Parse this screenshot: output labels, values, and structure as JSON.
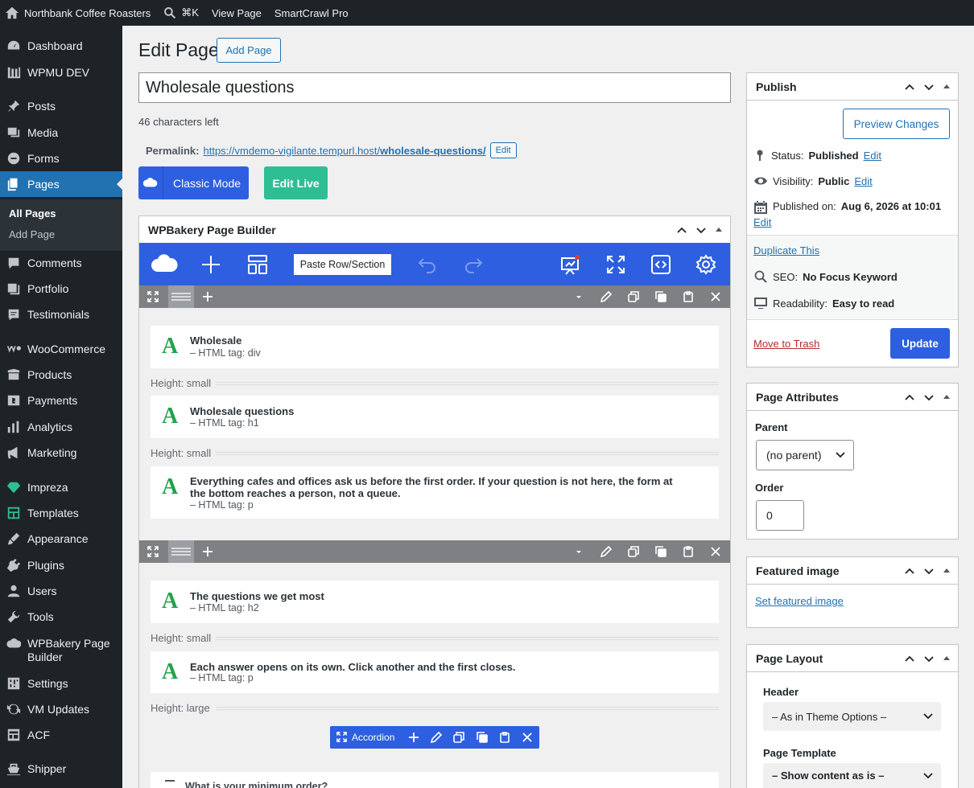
{
  "admin_bar": {
    "site_name": "Northbank Coffee Roasters",
    "search_shortcut": "⌘K",
    "view_page": "View Page",
    "plugin": "SmartCrawl Pro"
  },
  "sidebar": {
    "items": [
      {
        "label": "Dashboard",
        "icon": "dashboard-icon"
      },
      {
        "label": "WPMU DEV",
        "icon": "wpmudev-icon"
      },
      {
        "label": "Posts",
        "icon": "pin-icon"
      },
      {
        "label": "Media",
        "icon": "media-icon"
      },
      {
        "label": "Forms",
        "icon": "forms-icon"
      },
      {
        "label": "Pages",
        "icon": "pages-icon"
      },
      {
        "label": "Comments",
        "icon": "comments-icon"
      },
      {
        "label": "Portfolio",
        "icon": "portfolio-icon"
      },
      {
        "label": "Testimonials",
        "icon": "testimonials-icon"
      },
      {
        "label": "WooCommerce",
        "icon": "woocommerce-icon"
      },
      {
        "label": "Products",
        "icon": "products-icon"
      },
      {
        "label": "Payments",
        "icon": "payments-icon"
      },
      {
        "label": "Analytics",
        "icon": "analytics-icon"
      },
      {
        "label": "Marketing",
        "icon": "megaphone-icon"
      },
      {
        "label": "Impreza",
        "icon": "diamond-icon"
      },
      {
        "label": "Templates",
        "icon": "templates-icon"
      },
      {
        "label": "Appearance",
        "icon": "brush-icon"
      },
      {
        "label": "Plugins",
        "icon": "plug-icon"
      },
      {
        "label": "Users",
        "icon": "user-icon"
      },
      {
        "label": "Tools",
        "icon": "wrench-icon"
      },
      {
        "label": "WPBakery Page Builder",
        "icon": "wpbakery-icon"
      },
      {
        "label": "Settings",
        "icon": "settings-icon"
      },
      {
        "label": "VM Updates",
        "icon": "updates-icon"
      },
      {
        "label": "ACF",
        "icon": "acf-icon"
      },
      {
        "label": "Shipper",
        "icon": "shipper-icon"
      }
    ],
    "submenu": [
      "All Pages",
      "Add Page"
    ]
  },
  "editor": {
    "heading": "Edit Page",
    "add_page": "Add Page",
    "title_value": "Wholesale questions",
    "chars_left": "46 characters left",
    "permalink_label": "Permalink:",
    "permalink_base": "https://vmdemo-vigilante.tempurl.host/",
    "permalink_slug": "wholesale-questions/",
    "permalink_edit": "Edit",
    "classic_mode": "Classic Mode",
    "edit_live": "Edit Live"
  },
  "builder": {
    "title": "WPBakery Page Builder",
    "paste_label": "Paste Row/Section",
    "rows": [
      {
        "elements": [
          {
            "title": "Wholesale",
            "sub": "– HTML tag: div",
            "height": "Height: small"
          },
          {
            "title": "Wholesale questions",
            "sub": "– HTML tag: h1",
            "height": "Height: small"
          },
          {
            "title": "Everything cafes and offices ask us before the first order. If your question is not here, the form at the bottom reaches a person, not a queue.",
            "sub": "– HTML tag: p"
          }
        ]
      },
      {
        "elements": [
          {
            "title": "The questions we get most",
            "sub": "– HTML tag: h2",
            "height": "Height: small"
          },
          {
            "title": "Each answer opens on its own. Click another and the first closes.",
            "sub": "– HTML tag: p",
            "height": "Height: large"
          }
        ]
      }
    ],
    "accordion_label": "Accordion",
    "accordion_item": "What is your minimum order?"
  },
  "publish": {
    "title": "Publish",
    "preview": "Preview Changes",
    "status_label": "Status:",
    "status_value": "Published",
    "visibility_label": "Visibility:",
    "visibility_value": "Public",
    "published_label": "Published on:",
    "published_value": "Aug 6, 2026 at 10:01",
    "edit": "Edit",
    "duplicate": "Duplicate This",
    "seo_label": "SEO:",
    "seo_value": "No Focus Keyword",
    "readability_label": "Readability:",
    "readability_value": "Easy to read",
    "trash": "Move to Trash",
    "update": "Update"
  },
  "page_attributes": {
    "title": "Page Attributes",
    "parent_label": "Parent",
    "parent_value": "(no parent)",
    "order_label": "Order",
    "order_value": "0"
  },
  "featured_image": {
    "title": "Featured image",
    "set": "Set featured image"
  },
  "page_layout": {
    "title": "Page Layout",
    "header_label": "Header",
    "header_value": "– As in Theme Options –",
    "template_label": "Page Template",
    "template_value": "– Show content as is –"
  },
  "colors": {
    "admin_dark": "#1d2327",
    "wp_blue": "#2271b1",
    "wpbakery_blue": "#2d5fe0",
    "edit_live_green": "#2ebe94",
    "element_green": "#22a34a"
  }
}
